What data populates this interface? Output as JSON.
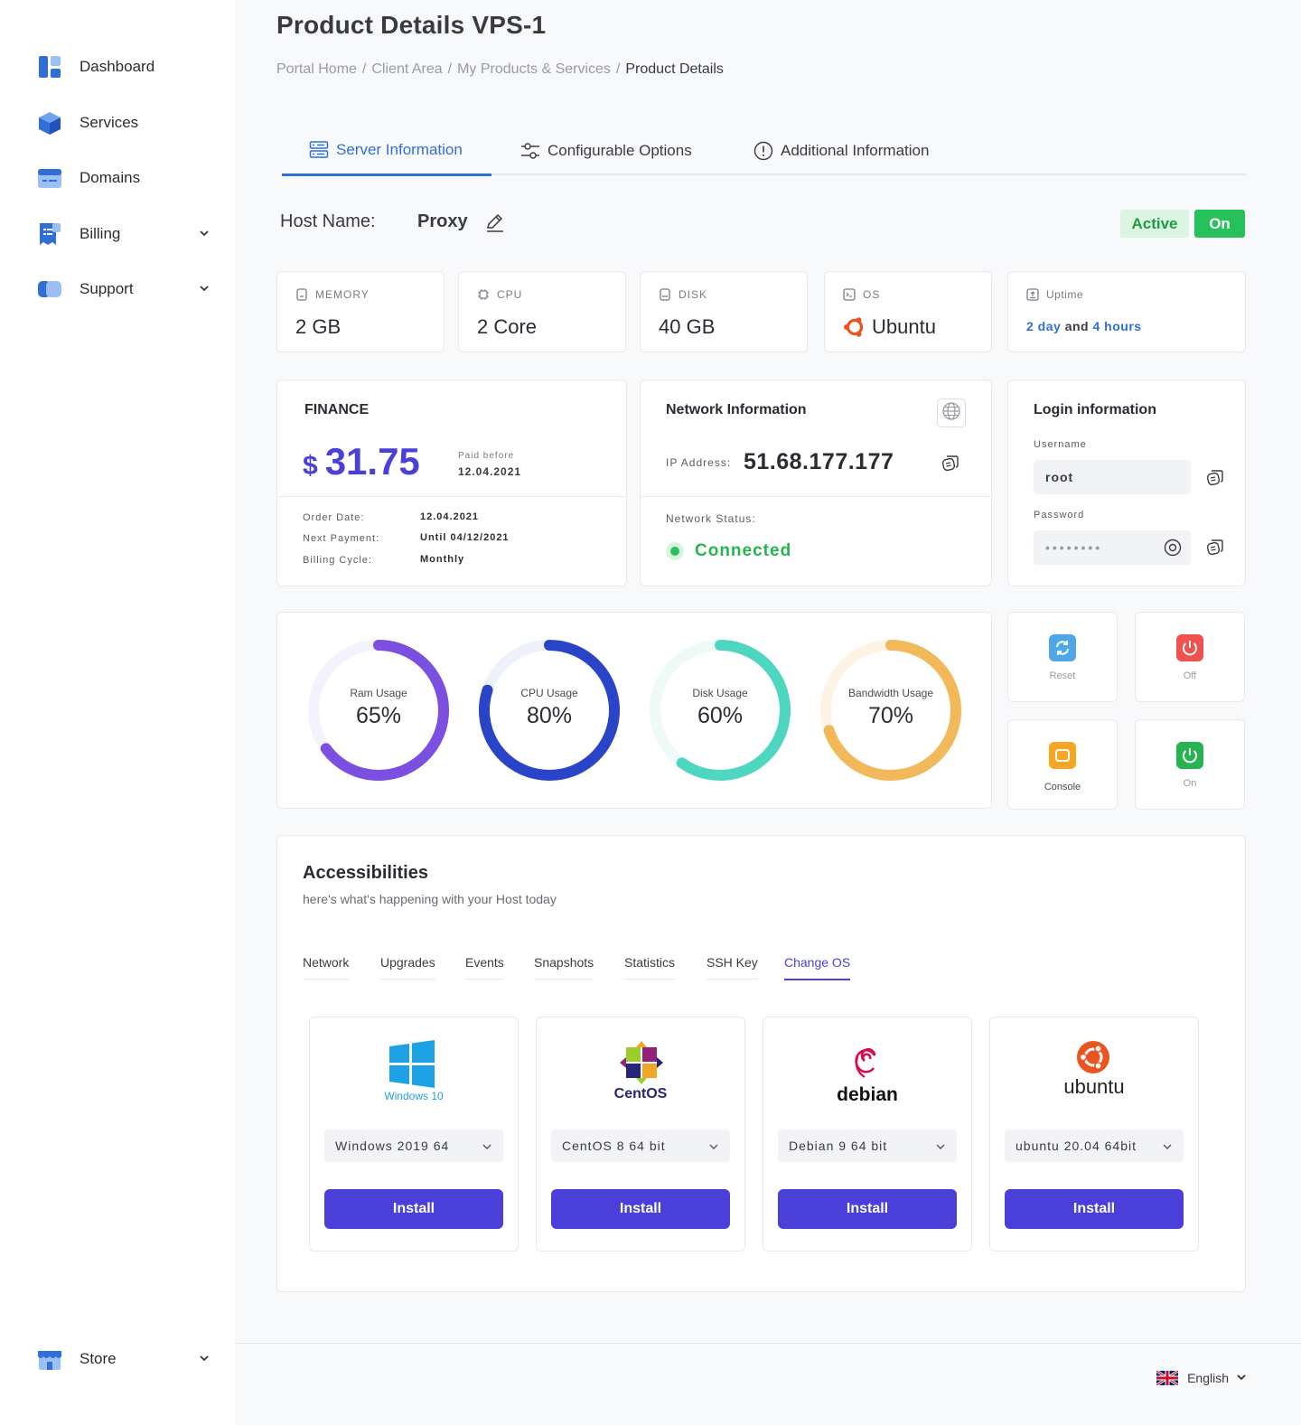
{
  "sidebar": {
    "items": [
      {
        "label": "Dashboard",
        "icon": "dashboard-icon"
      },
      {
        "label": "Services",
        "icon": "cube-icon"
      },
      {
        "label": "Domains",
        "icon": "browser-icon"
      },
      {
        "label": "Billing",
        "icon": "receipt-icon",
        "expandable": true
      },
      {
        "label": "Support",
        "icon": "chat-icon",
        "expandable": true
      }
    ],
    "store": {
      "label": "Store",
      "icon": "store-icon"
    }
  },
  "page": {
    "title": "Product Details VPS-1",
    "breadcrumb": [
      "Portal Home",
      "Client Area",
      "My Products & Services",
      "Product Details"
    ]
  },
  "tabs": [
    {
      "label": "Server Information",
      "icon": "server-icon",
      "active": true
    },
    {
      "label": "Configurable Options",
      "icon": "sliders-icon"
    },
    {
      "label": "Additional Information",
      "icon": "info-icon"
    }
  ],
  "host": {
    "label": "Host Name:",
    "value": "Proxy",
    "status": "Active",
    "power": "On"
  },
  "specs": {
    "memory": {
      "label": "MEMORY",
      "value": "2 GB"
    },
    "cpu": {
      "label": "CPU",
      "value": "2 Core"
    },
    "disk": {
      "label": "DISK",
      "value": "40 GB"
    },
    "os": {
      "label": "OS",
      "value": "Ubuntu"
    },
    "uptime": {
      "label": "Uptime",
      "days": "2 day",
      "and": "and",
      "hours": "4 hours"
    }
  },
  "finance": {
    "title": "FINANCE",
    "currency": "$",
    "amount": "31.75",
    "paid_before_label": "Paid before",
    "paid_before_date": "12.04.2021",
    "order_date_label": "Order Date:",
    "order_date": "12.04.2021",
    "next_payment_label": "Next Payment:",
    "next_payment": "Until 04/12/2021",
    "billing_cycle_label": "Billing Cycle:",
    "billing_cycle": "Monthly"
  },
  "network": {
    "title": "Network Information",
    "ip_label": "IP Address:",
    "ip": "51.68.177.177",
    "status_label": "Network Status:",
    "status": "Connected"
  },
  "login": {
    "title": "Login information",
    "username_label": "Username",
    "username": "root",
    "password_label": "Password",
    "password_mask": "••••••••"
  },
  "usage": [
    {
      "label": "Ram Usage",
      "value": "65%",
      "percent": 0.65,
      "color": "#7b4fe0",
      "track": "#f4f2fc"
    },
    {
      "label": "CPU Usage",
      "value": "80%",
      "percent": 0.8,
      "color": "#2a44c8",
      "track": "#eef0fb"
    },
    {
      "label": "Disk Usage",
      "value": "60%",
      "percent": 0.6,
      "color": "#4fd6c0",
      "track": "#eefaf7"
    },
    {
      "label": "Bandwidth Usage",
      "value": "70%",
      "percent": 0.7,
      "color": "#f2b95b",
      "track": "#fdf4e6"
    }
  ],
  "actions": {
    "reset": {
      "label": "Reset",
      "color": "#4ea8e8"
    },
    "off": {
      "label": "Off",
      "color": "#f0524f"
    },
    "console": {
      "label": "Console",
      "color": "#f5a623"
    },
    "on": {
      "label": "On",
      "color": "#26b453"
    }
  },
  "accessibilities": {
    "title": "Accessibilities",
    "subtitle": "here's what's happening with your Host today",
    "tabs": [
      "Network",
      "Upgrades",
      "Events",
      "Snapshots",
      "Statistics",
      "SSH Key",
      "Change OS"
    ],
    "active_tab": "Change OS",
    "os_options": [
      {
        "logo_text": "Windows 10",
        "selected": "Windows 2019 64",
        "button": "Install"
      },
      {
        "logo_text": "CentOS",
        "selected": "CentOS 8 64 bit",
        "button": "Install"
      },
      {
        "logo_text": "debian",
        "selected": "Debian 9 64 bit",
        "button": "Install"
      },
      {
        "logo_text": "ubuntu",
        "selected": "ubuntu 20.04 64bit",
        "button": "Install"
      }
    ]
  },
  "footer": {
    "language": "English"
  }
}
